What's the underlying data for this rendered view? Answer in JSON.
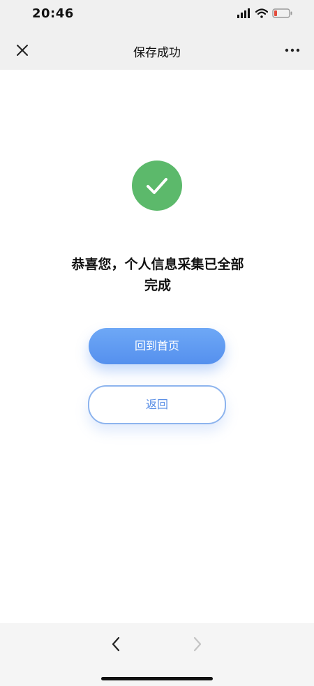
{
  "status_bar": {
    "time": "20:46"
  },
  "nav": {
    "title": "保存成功",
    "close_icon": "close-icon",
    "more_icon": "more-icon"
  },
  "main": {
    "success_icon": "check-circle-icon",
    "message": "恭喜您，个人信息采集已全部完成",
    "primary_button": "回到首页",
    "secondary_button": "返回"
  },
  "bottom_bar": {
    "back_icon": "chevron-left-icon",
    "forward_icon": "chevron-right-icon"
  },
  "colors": {
    "success": "#5cb96b",
    "primary": "#5b8fe6",
    "bar_background": "#f0f0f0"
  }
}
